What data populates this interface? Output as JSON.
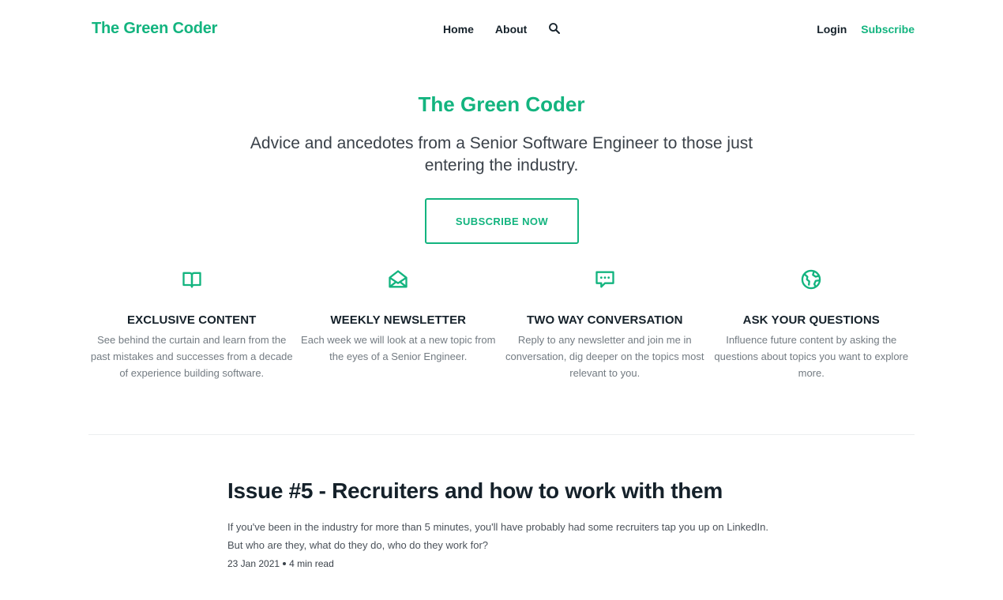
{
  "header": {
    "logo": "The Green Coder",
    "nav": [
      {
        "label": "Home"
      },
      {
        "label": "About"
      }
    ],
    "search_icon": "search-icon",
    "login_label": "Login",
    "subscribe_label": "Subscribe"
  },
  "hero": {
    "title": "The Green Coder",
    "description": "Advice and ancedotes from a Senior Software Engineer to those just entering the industry.",
    "cta_label": "SUBSCRIBE NOW"
  },
  "features": [
    {
      "icon": "book-icon",
      "title": "EXCLUSIVE CONTENT",
      "text": "See behind the curtain and learn from the past mistakes and successes from a decade of experience building software."
    },
    {
      "icon": "envelope-icon",
      "title": "WEEKLY NEWSLETTER",
      "text": "Each week we will look at a new topic from the eyes of a Senior Engineer."
    },
    {
      "icon": "chat-bubble-icon",
      "title": "TWO WAY CONVERSATION",
      "text": "Reply to any newsletter and join me in conversation, dig deeper on the topics most relevant to you."
    },
    {
      "icon": "globe-icon",
      "title": "ASK YOUR QUESTIONS",
      "text": "Influence future content by asking the questions about topics you want to explore more."
    }
  ],
  "post": {
    "title": "Issue #5 - Recruiters and how to work with them",
    "excerpt": "If you've been in the industry for more than 5 minutes, you'll have probably had some recruiters tap you up on LinkedIn. But who are they, what do they do, who do they work for?",
    "date": "23 Jan 2021",
    "read_time": "4 min read"
  },
  "colors": {
    "accent": "#13b47f",
    "text": "#15212a",
    "muted": "#737b82"
  }
}
